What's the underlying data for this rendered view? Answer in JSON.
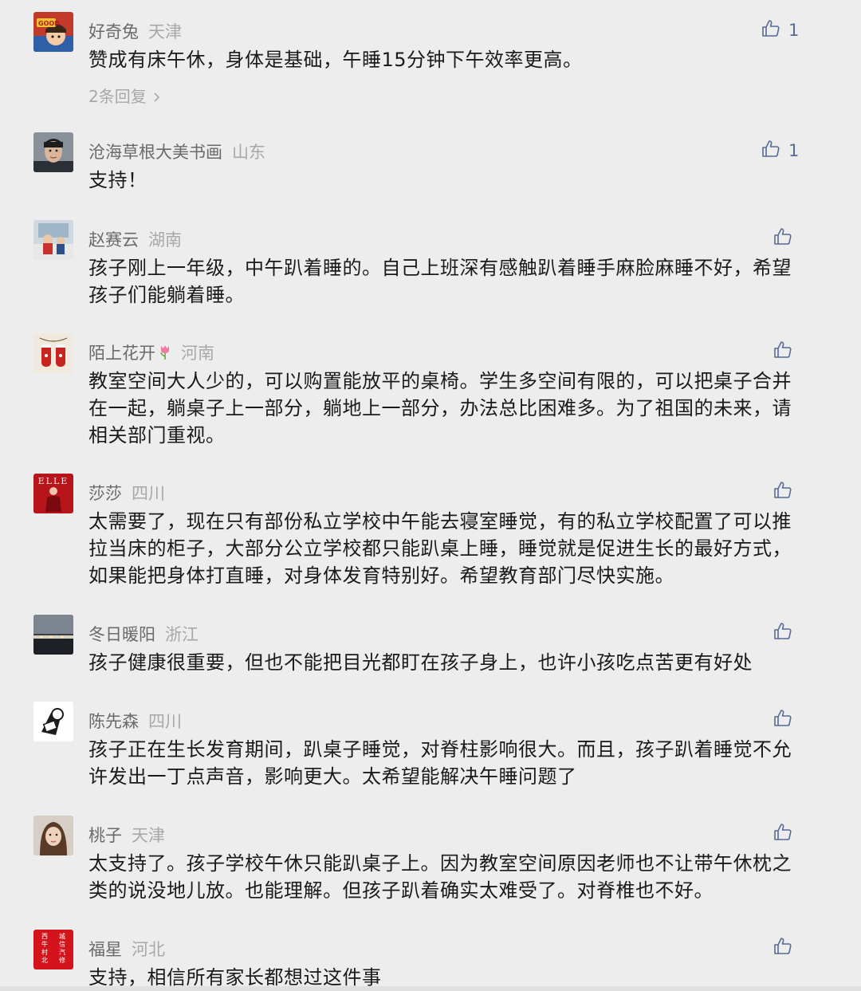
{
  "colors": {
    "background": "#ededed",
    "nickname": "#6a6a6a",
    "location": "#a8a8a8",
    "text": "#1a1a1a",
    "like_icon": "#576b95"
  },
  "comments": [
    {
      "nickname": "好奇兔",
      "location": "天津",
      "text": "赞成有床午休，身体是基础，午睡15分钟下午效率更高。",
      "likes": "1",
      "replies": "2条回复",
      "avatar_icon": "cartoon-avatar-icon"
    },
    {
      "nickname": "沧海草根大美书画",
      "location": "山东",
      "text": "支持！",
      "likes": "1",
      "avatar_icon": "man-portrait-avatar-icon"
    },
    {
      "nickname": "赵赛云",
      "location": "湖南",
      "text": "孩子刚上一年级，中午趴着睡的。自己上班深有感触趴着睡手麻脸麻睡不好，希望孩子们能躺着睡。",
      "avatar_icon": "child-photo-avatar-icon"
    },
    {
      "nickname": "陌上花开",
      "location": "河南",
      "text": "教室空间大人少的，可以购置能放平的桌椅。学生多空间有限的，可以把桌子合并在一起，躺桌子上一部分，躺地上一部分，办法总比困难多。为了祖国的未来，请相关部门重视。",
      "avatar_icon": "red-mittens-avatar-icon"
    },
    {
      "nickname": "莎莎",
      "location": "四川",
      "text": "太需要了，现在只有部份私立学校中午能去寝室睡觉，有的私立学校配置了可以推拉当床的柜子，大部分公立学校都只能趴桌上睡，睡觉就是促进生长的最好方式，如果能把身体打直睡，对身体发育特别好。希望教育部门尽快实施。",
      "avatar_icon": "elle-magazine-avatar-icon"
    },
    {
      "nickname": "冬日暖阳",
      "location": "浙江",
      "text": "孩子健康很重要，但也不能把目光都盯在孩子身上，也许小孩吃点苦更有好处",
      "avatar_icon": "night-city-avatar-icon"
    },
    {
      "nickname": "陈先森",
      "location": "四川",
      "text": "孩子正在生长发育期间，趴桌子睡觉，对脊柱影响很大。而且，孩子趴着睡觉不允许发出一丁点声音，影响更大。太希望能解决午睡问题了",
      "avatar_icon": "cartoon-sketch-avatar-icon"
    },
    {
      "nickname": "桃子",
      "location": "天津",
      "text": "太支持了。孩子学校午休只能趴桌子上。因为教室空间原因老师也不让带午休枕之类的说没地儿放。也能理解。但孩子趴着确实太难受了。对脊椎也不好。",
      "avatar_icon": "woman-portrait-avatar-icon"
    },
    {
      "nickname": "福星",
      "location": "河北",
      "text": "支持，相信所有家长都想过这件事",
      "avatar_icon": "red-sign-avatar-icon"
    }
  ],
  "avatar_5_text": "ELLE",
  "avatar_9_lines": [
    "西",
    "城",
    "牛",
    "信",
    "村",
    "汽",
    "北",
    "修"
  ]
}
